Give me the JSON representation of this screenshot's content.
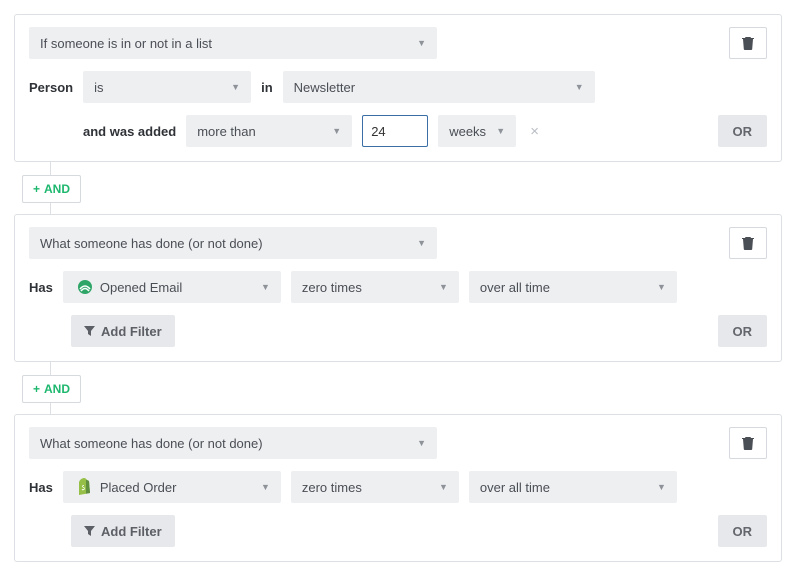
{
  "card1": {
    "condition_type": "If someone is in or not in a list",
    "person_label": "Person",
    "person_op": "is",
    "in_label": "in",
    "list_name": "Newsletter",
    "added_label": "and was added",
    "comparator": "more than",
    "number": "24",
    "unit": "weeks"
  },
  "card2": {
    "condition_type": "What someone has done (or not done)",
    "has_label": "Has",
    "event": "Opened Email",
    "count": "zero times",
    "timeframe": "over all time",
    "add_filter": "Add Filter"
  },
  "card3": {
    "condition_type": "What someone has done (or not done)",
    "has_label": "Has",
    "event": "Placed Order",
    "count": "zero times",
    "timeframe": "over all time",
    "add_filter": "Add Filter"
  },
  "buttons": {
    "or": "OR",
    "and": "AND"
  }
}
